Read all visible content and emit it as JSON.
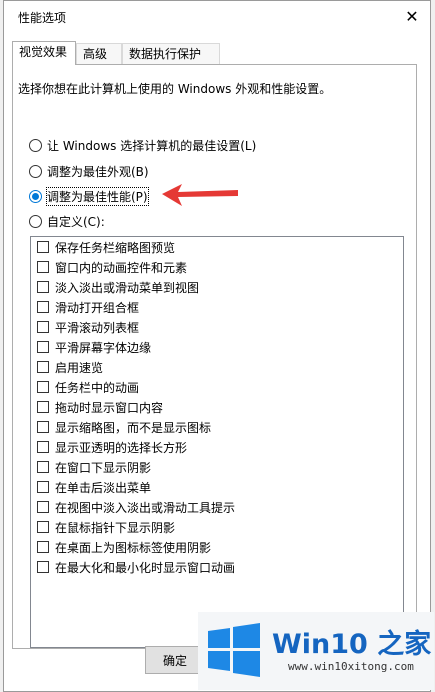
{
  "window": {
    "title": "性能选项",
    "close_glyph": "✕"
  },
  "tabs": [
    {
      "label": "视觉效果",
      "active": true
    },
    {
      "label": "高级",
      "active": false
    },
    {
      "label": "数据执行保护",
      "active": false
    }
  ],
  "description": "选择你想在此计算机上使用的 Windows 外观和性能设置。",
  "radios": [
    {
      "label": "让 Windows 选择计算机的最佳设置(L)",
      "checked": false
    },
    {
      "label": "调整为最佳外观(B)",
      "checked": false
    },
    {
      "label": "调整为最佳性能(P)",
      "checked": true
    },
    {
      "label": "自定义(C):",
      "checked": false
    }
  ],
  "effects": [
    "保存任务栏缩略图预览",
    "窗口内的动画控件和元素",
    "淡入淡出或滑动菜单到视图",
    "滑动打开组合框",
    "平滑滚动列表框",
    "平滑屏幕字体边缘",
    "启用速览",
    "任务栏中的动画",
    "拖动时显示窗口内容",
    "显示缩略图，而不是显示图标",
    "显示亚透明的选择长方形",
    "在窗口下显示阴影",
    "在单击后淡出菜单",
    "在视图中淡入淡出或滑动工具提示",
    "在鼠标指针下显示阴影",
    "在桌面上为图标标签使用阴影",
    "在最大化和最小化时显示窗口动画"
  ],
  "buttons": {
    "ok": "确定"
  },
  "watermark": {
    "brand": "Win10 之家",
    "url": "www.win10xitong.com"
  },
  "colors": {
    "accent": "#0078d7",
    "arrow": "#e53935",
    "brand": "#1565c0"
  }
}
